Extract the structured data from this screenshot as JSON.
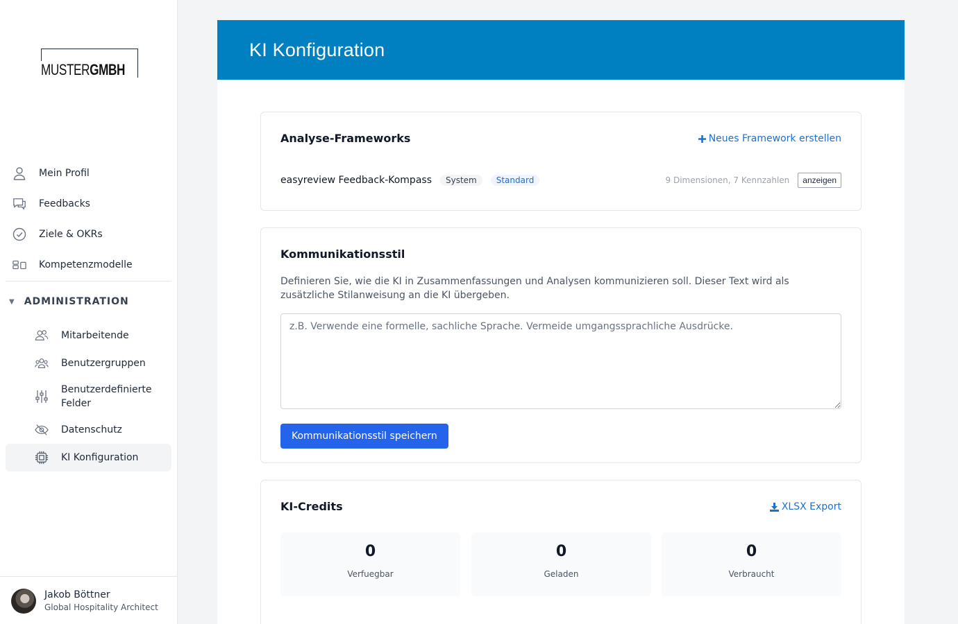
{
  "logo": {
    "light": "MUSTER",
    "bold": "GMBH"
  },
  "nav": {
    "items": [
      {
        "label": "Mein Profil",
        "icon": "user-icon"
      },
      {
        "label": "Feedbacks",
        "icon": "chat-icon"
      },
      {
        "label": "Ziele & OKRs",
        "icon": "check-circle-icon"
      },
      {
        "label": "Kompetenzmodelle",
        "icon": "blocks-icon"
      }
    ],
    "admin_label": "ADMINISTRATION",
    "admin_items": [
      {
        "label": "Mitarbeitende",
        "icon": "users-icon"
      },
      {
        "label": "Benutzergruppen",
        "icon": "user-group-icon"
      },
      {
        "label": "Benutzerdefinierte Felder",
        "icon": "sliders-icon"
      },
      {
        "label": "Datenschutz",
        "icon": "eye-off-icon"
      },
      {
        "label": "KI Konfiguration",
        "icon": "cpu-icon"
      }
    ]
  },
  "user": {
    "name": "Jakob Böttner",
    "role": "Global Hospitality Architect"
  },
  "page": {
    "title": "KI Konfiguration"
  },
  "frameworks": {
    "title": "Analyse-Frameworks",
    "create_link": "Neues Framework erstellen",
    "item": {
      "name": "easyreview Feedback-Kompass",
      "badge_system": "System",
      "badge_standard": "Standard",
      "meta": "9 Dimensionen, 7 Kennzahlen",
      "button": "anzeigen"
    }
  },
  "style": {
    "title": "Kommunikationsstil",
    "description": "Definieren Sie, wie die KI in Zusammenfassungen und Analysen kommunizieren soll. Dieser Text wird als zusätzliche Stilanweisung an die KI übergeben.",
    "placeholder": "z.B. Verwende eine formelle, sachliche Sprache. Vermeide umgangssprachliche Ausdrücke.",
    "value": "",
    "save_label": "Kommunikationsstil speichern"
  },
  "credits": {
    "title": "KI-Credits",
    "export_link": "XLSX Export",
    "stats": [
      {
        "value": "0",
        "label": "Verfuegbar"
      },
      {
        "value": "0",
        "label": "Geladen"
      },
      {
        "value": "0",
        "label": "Verbraucht"
      }
    ]
  },
  "colors": {
    "banner": "#0080c0",
    "primary_button": "#2563eb",
    "link": "#1d6fd1"
  }
}
